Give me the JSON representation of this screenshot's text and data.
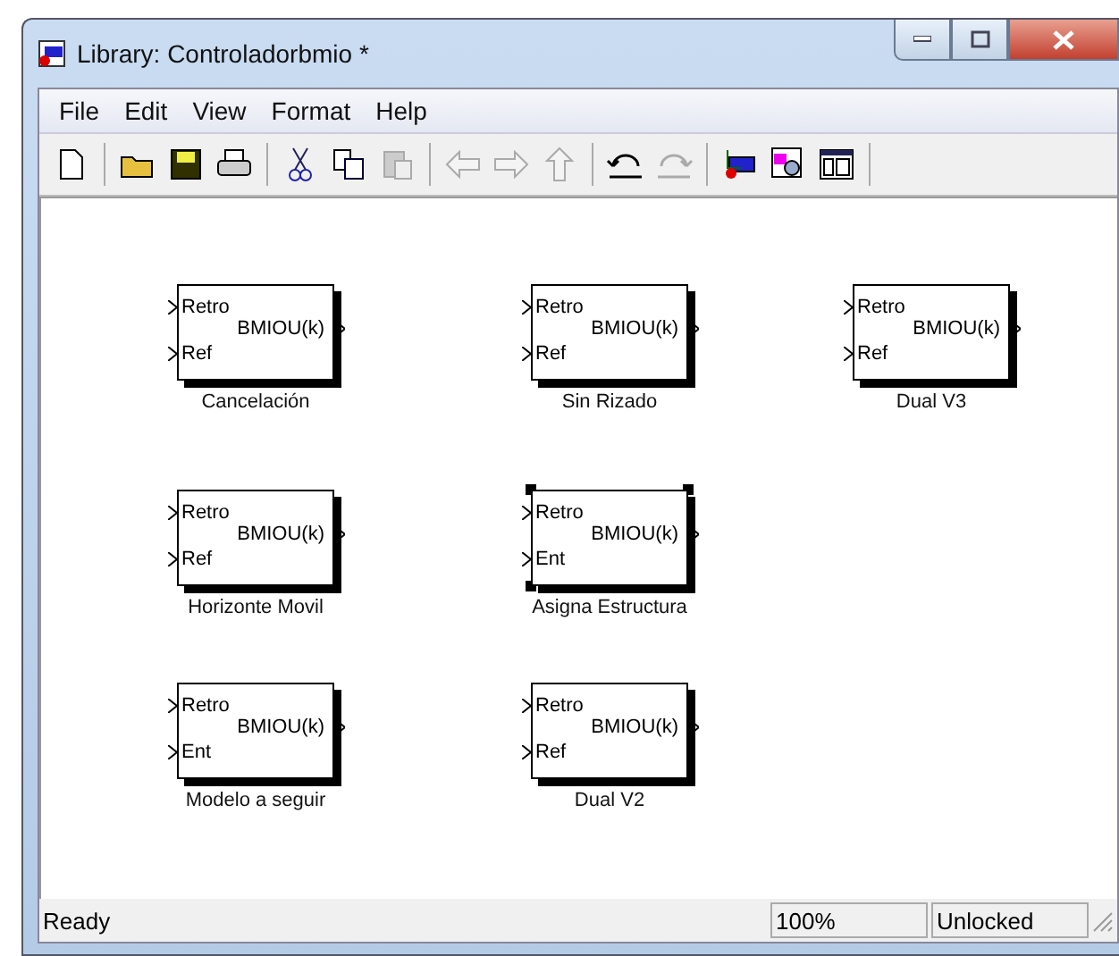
{
  "window": {
    "title": "Library: Controladorbmio *"
  },
  "menu": [
    "File",
    "Edit",
    "View",
    "Format",
    "Help"
  ],
  "toolbar": [
    {
      "kind": "new",
      "disabled": false
    },
    {
      "kind": "sep"
    },
    {
      "kind": "open",
      "disabled": false
    },
    {
      "kind": "save",
      "disabled": false
    },
    {
      "kind": "print",
      "disabled": false
    },
    {
      "kind": "sep"
    },
    {
      "kind": "cut",
      "disabled": false
    },
    {
      "kind": "copy",
      "disabled": false
    },
    {
      "kind": "paste",
      "disabled": true
    },
    {
      "kind": "sep"
    },
    {
      "kind": "back",
      "disabled": true
    },
    {
      "kind": "forward",
      "disabled": true
    },
    {
      "kind": "up",
      "disabled": true
    },
    {
      "kind": "sep"
    },
    {
      "kind": "undo",
      "disabled": false
    },
    {
      "kind": "redo",
      "disabled": true
    },
    {
      "kind": "sep"
    },
    {
      "kind": "model",
      "disabled": false
    },
    {
      "kind": "explore",
      "disabled": false
    },
    {
      "kind": "browser",
      "disabled": false
    },
    {
      "kind": "sep"
    }
  ],
  "blocks": [
    {
      "name": "Cancelación",
      "inputs": [
        "Retro",
        "Ref"
      ],
      "output": "BMIOU(k)",
      "selected": false
    },
    {
      "name": "Sin Rizado",
      "inputs": [
        "Retro",
        "Ref"
      ],
      "output": "BMIOU(k)",
      "selected": false
    },
    {
      "name": "Dual V3",
      "inputs": [
        "Retro",
        "Ref"
      ],
      "output": "BMIOU(k)",
      "selected": false
    },
    {
      "name": "Horizonte Movil",
      "inputs": [
        "Retro",
        "Ref"
      ],
      "output": "BMIOU(k)",
      "selected": false
    },
    {
      "name": "Asigna Estructura",
      "inputs": [
        "Retro",
        "Ent"
      ],
      "output": "BMIOU(k)",
      "selected": true
    },
    {
      "name": "Modelo a seguir",
      "inputs": [
        "Retro",
        "Ent"
      ],
      "output": "BMIOU(k)",
      "selected": false
    },
    {
      "name": "Dual V2",
      "inputs": [
        "Retro",
        "Ref"
      ],
      "output": "BMIOU(k)",
      "selected": false
    }
  ],
  "status_bar": {
    "message": "Ready",
    "zoom": "100%",
    "lock": "Unlocked"
  }
}
